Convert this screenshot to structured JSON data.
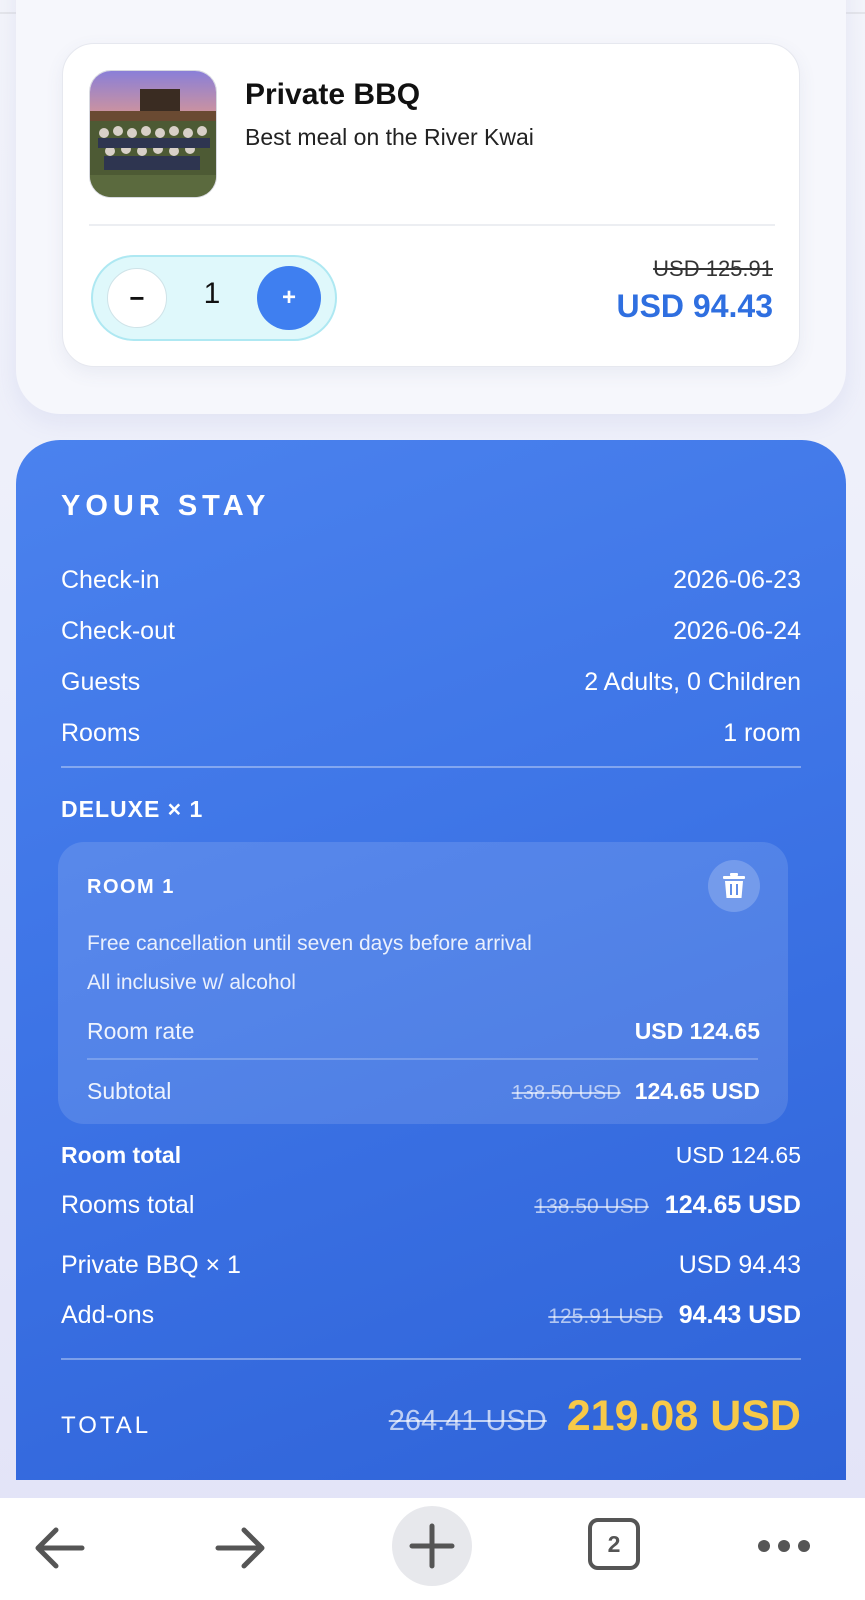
{
  "addon": {
    "title": "Private BBQ",
    "subtitle": "Best meal on the River Kwai",
    "quantity": "1",
    "minus_label": "−",
    "plus_label": "+",
    "original_price": "USD 125.91",
    "price": "USD 94.43"
  },
  "stay": {
    "heading": "YOUR STAY",
    "rows": [
      {
        "label": "Check-in",
        "value": "2026-06-23"
      },
      {
        "label": "Check-out",
        "value": "2026-06-24"
      },
      {
        "label": "Guests",
        "value": "2 Adults, 0 Children"
      },
      {
        "label": "Rooms",
        "value": "1 room"
      }
    ],
    "room_type": "DELUXE × 1",
    "room": {
      "title": "ROOM 1",
      "policy": "Free cancellation until seven days before arrival",
      "board": "All inclusive w/ alcohol",
      "rate_label": "Room rate",
      "rate_value": "USD 124.65",
      "subtotal_label": "Subtotal",
      "subtotal_old": "138.50 USD",
      "subtotal_new": "124.65 USD"
    },
    "room_total_label": "Room total",
    "room_total_value": "USD 124.65",
    "rooms_total_label": "Rooms total",
    "rooms_total_old": "138.50 USD",
    "rooms_total_new": "124.65 USD",
    "addon_line_label": "Private BBQ × 1",
    "addon_line_value": "USD 94.43",
    "addons_label": "Add-ons",
    "addons_old": "125.91 USD",
    "addons_new": "94.43 USD",
    "total_label": "TOTAL",
    "total_old": "264.41 USD",
    "total_new": "219.08 USD"
  },
  "browser": {
    "tab_count": "2",
    "icons": [
      "back-arrow-icon",
      "forward-arrow-icon",
      "plus-icon",
      "tab-count-icon",
      "more-icon"
    ]
  },
  "colors": {
    "accent": "#3f7ff0",
    "panel": "#3d74e6",
    "total_highlight": "#f7c948"
  }
}
